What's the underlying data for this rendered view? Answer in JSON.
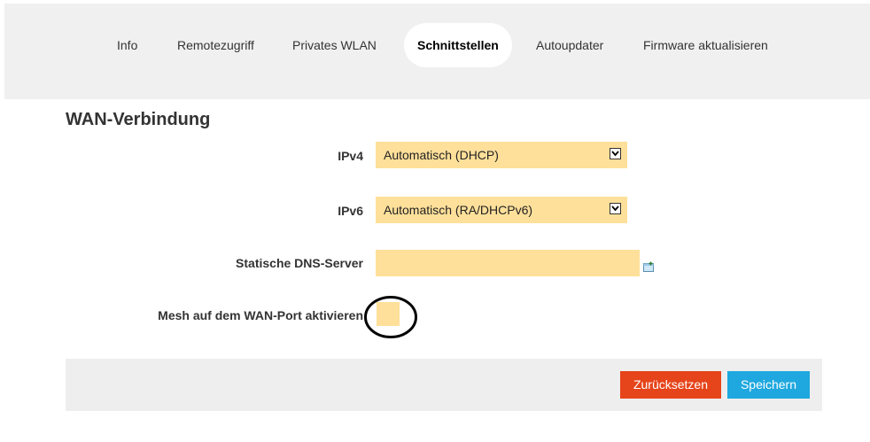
{
  "nav": {
    "tabs": [
      {
        "label": "Info",
        "active": false
      },
      {
        "label": "Remotezugriff",
        "active": false
      },
      {
        "label": "Privates WLAN",
        "active": false
      },
      {
        "label": "Schnittstellen",
        "active": true
      },
      {
        "label": "Autoupdater",
        "active": false
      },
      {
        "label": "Firmware aktualisieren",
        "active": false
      }
    ]
  },
  "wan": {
    "title": "WAN-Verbindung",
    "ipv4": {
      "label": "IPv4",
      "value": "Automatisch (DHCP)"
    },
    "ipv6": {
      "label": "IPv6",
      "value": "Automatisch (RA/DHCPv6)"
    },
    "dns": {
      "label": "Statische DNS-Server",
      "value": ""
    },
    "mesh": {
      "label": "Mesh auf dem WAN-Port aktivieren",
      "checked": false
    }
  },
  "actions": {
    "reset_label": "Zurücksetzen",
    "save_label": "Speichern"
  },
  "colors": {
    "field_bg": "#ffe09a",
    "reset": "#e6441a",
    "save": "#1ea8df",
    "annotation_ring": "#000000"
  }
}
